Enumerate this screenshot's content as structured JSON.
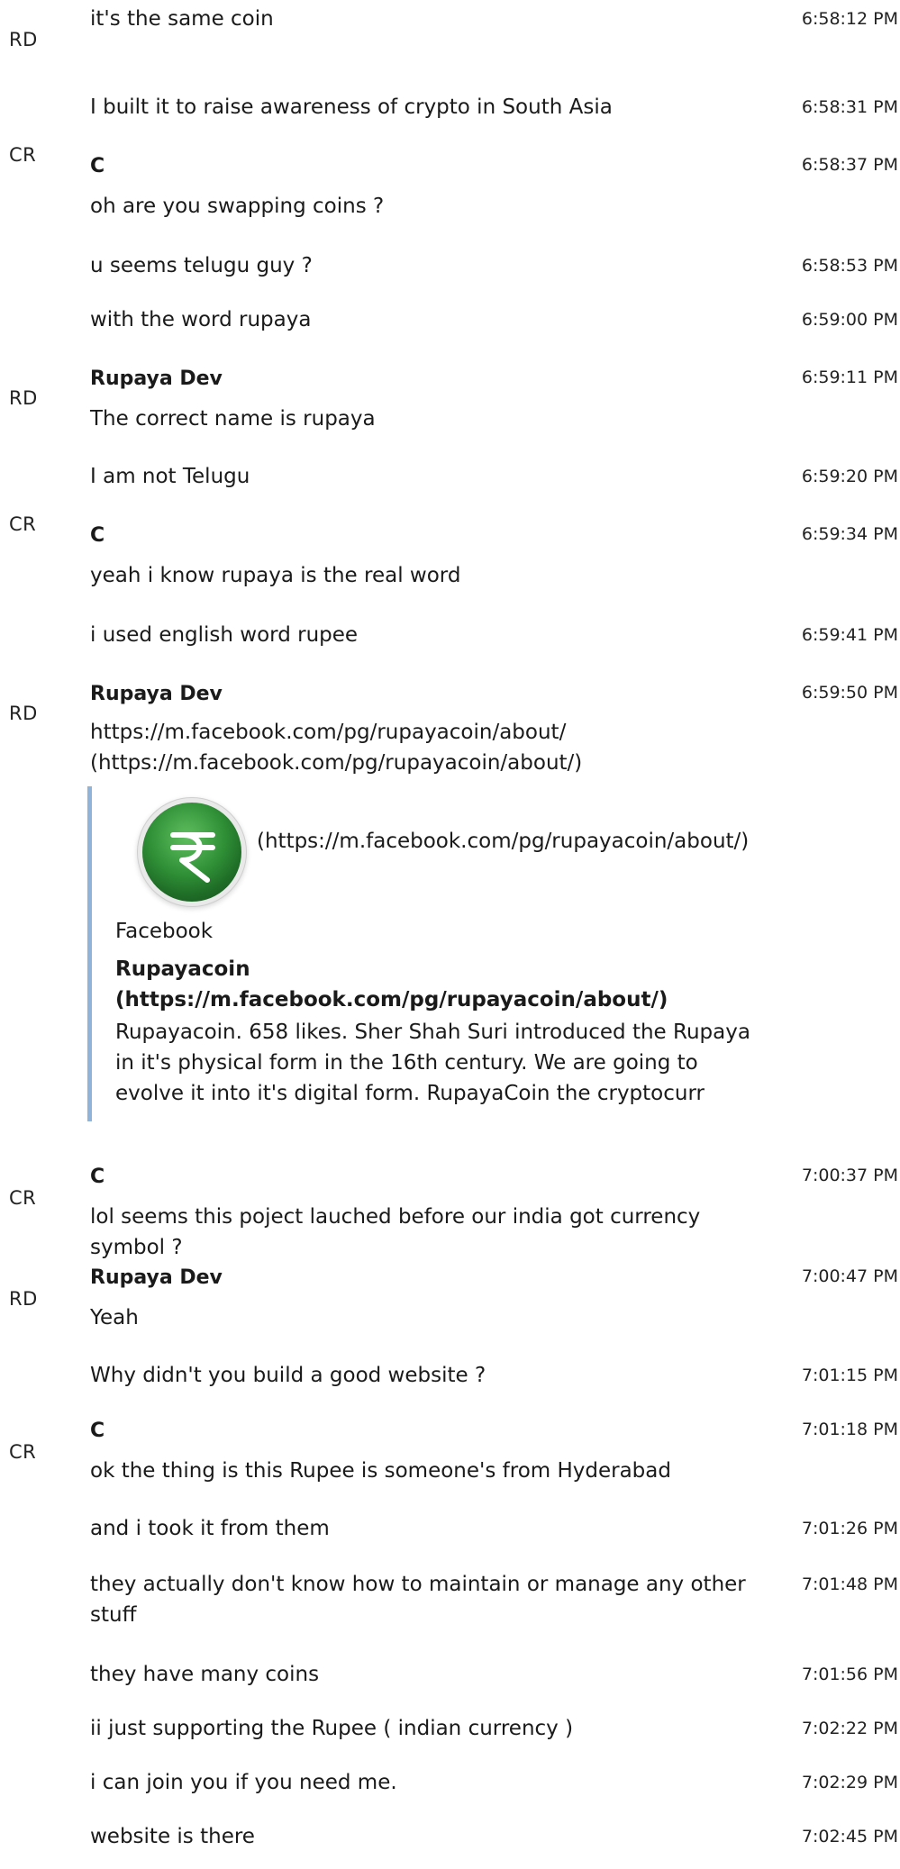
{
  "messages": [
    {
      "avatar": "RD",
      "sender": "",
      "text": "it's the same coin",
      "time": "6:58:12 PM"
    },
    {
      "avatar": "",
      "sender": "",
      "text": "I built it to raise awareness of crypto in South Asia",
      "time": "6:58:31 PM"
    },
    {
      "avatar": "CR",
      "sender": "C",
      "text": "oh are you swapping coins ?",
      "time": "6:58:37 PM"
    },
    {
      "avatar": "",
      "sender": "",
      "text": "u seems telugu guy ?",
      "time": "6:58:53 PM"
    },
    {
      "avatar": "",
      "sender": "",
      "text": "with the word rupaya",
      "time": "6:59:00 PM"
    },
    {
      "avatar": "RD",
      "sender": "Rupaya Dev",
      "text": "The correct name is rupaya",
      "time": "6:59:11 PM"
    },
    {
      "avatar": "",
      "sender": "",
      "text": "I am not Telugu",
      "time": "6:59:20 PM"
    },
    {
      "avatar": "CR",
      "sender": "C",
      "text": "yeah i know rupaya is the real word",
      "time": "6:59:34 PM"
    },
    {
      "avatar": "",
      "sender": "",
      "text": "i used english word rupee",
      "time": "6:59:41 PM"
    },
    {
      "avatar": "RD",
      "sender": "Rupaya Dev",
      "text": "https://m.facebook.com/pg/rupayacoin/about/ (https://m.facebook.com/pg/rupayacoin/about/)",
      "time": "6:59:50 PM"
    },
    {
      "avatar": "CR",
      "sender": "C",
      "text": "lol seems this poject lauched before our india got currency symbol ?",
      "time": "7:00:37 PM"
    },
    {
      "avatar": "RD",
      "sender": "Rupaya Dev",
      "text": "Yeah",
      "time": "7:00:47 PM"
    },
    {
      "avatar": "",
      "sender": "",
      "text": "Why didn't you build a good website ?",
      "time": "7:01:15 PM"
    },
    {
      "avatar": "CR",
      "sender": "C",
      "text": "ok the thing is this Rupee is someone's from Hyderabad",
      "time": "7:01:18 PM"
    },
    {
      "avatar": "",
      "sender": "",
      "text": "and i took it from them",
      "time": "7:01:26 PM"
    },
    {
      "avatar": "",
      "sender": "",
      "text": "they actually don't know how to maintain or manage any other stuff",
      "time": "7:01:48 PM"
    },
    {
      "avatar": "",
      "sender": "",
      "text": "they have many coins",
      "time": "7:01:56 PM"
    },
    {
      "avatar": "",
      "sender": "",
      "text": "ii just supporting the Rupee ( indian currency )",
      "time": "7:02:22 PM"
    },
    {
      "avatar": "",
      "sender": "",
      "text": "i can join you if you need me.",
      "time": "7:02:29 PM"
    },
    {
      "avatar": "",
      "sender": "",
      "text": "website is there",
      "time": "7:02:45 PM"
    }
  ],
  "link_preview": {
    "url_text": "(https://m.facebook.com/pg/rupayacoin/about/)",
    "site": "Facebook",
    "title": "Rupayacoin (https://m.facebook.com/pg/rupayacoin/about/)",
    "description": "Rupayacoin. 658 likes. Sher Shah Suri introduced the Rupaya in it's physical form in the 16th century. We are going to evolve it into it's digital form. RupayaCoin the cryptocurr",
    "thumb_icon": "rupayacoin-logo-icon"
  }
}
